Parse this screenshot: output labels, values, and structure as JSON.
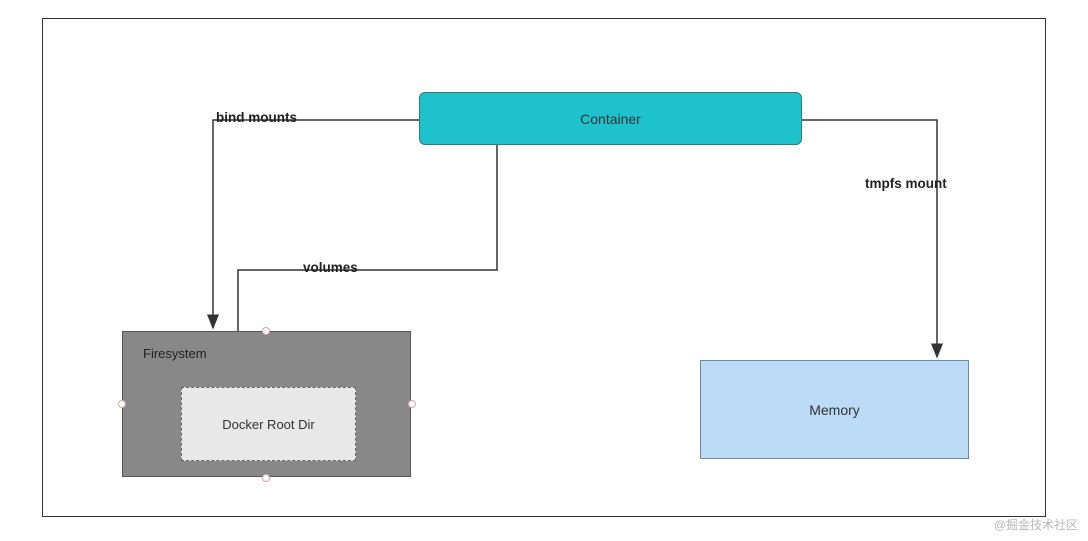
{
  "nodes": {
    "container": "Container",
    "filesystem": "Firesystem",
    "docker_root": "Docker Root Dir",
    "memory": "Memory"
  },
  "edges": {
    "bind_mounts": "bind mounts",
    "volumes": "volumes",
    "tmpfs": "tmpfs mount"
  },
  "watermark": "@掘金技术社区"
}
